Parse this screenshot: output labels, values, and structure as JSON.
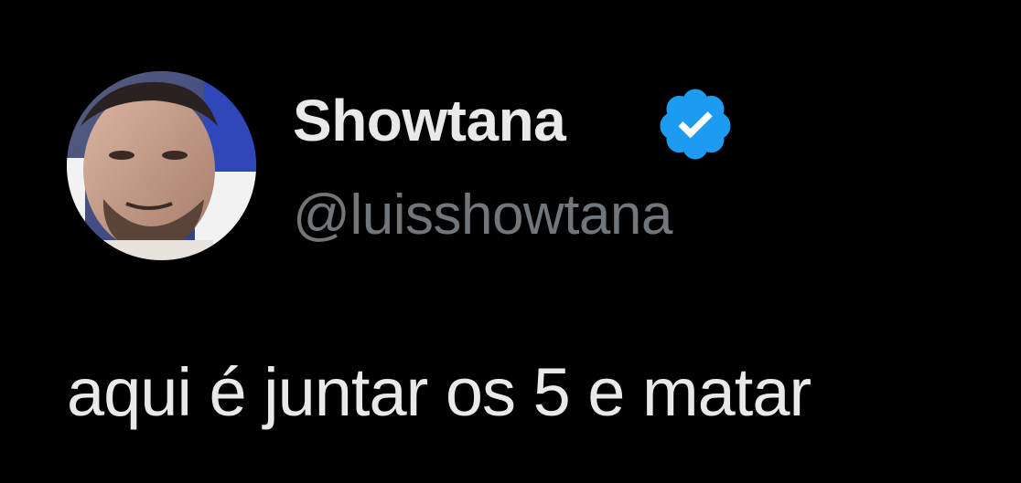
{
  "tweet": {
    "author": {
      "display_name": "Showtana",
      "handle": "@luisshowtana",
      "verified": true,
      "avatar_icon": "profile-photo"
    },
    "text": "aqui é juntar os 5 e matar"
  },
  "colors": {
    "background": "#000000",
    "primary_text": "#e7e9ea",
    "secondary_text": "#71767b",
    "verified_blue": "#1d9bf0"
  }
}
